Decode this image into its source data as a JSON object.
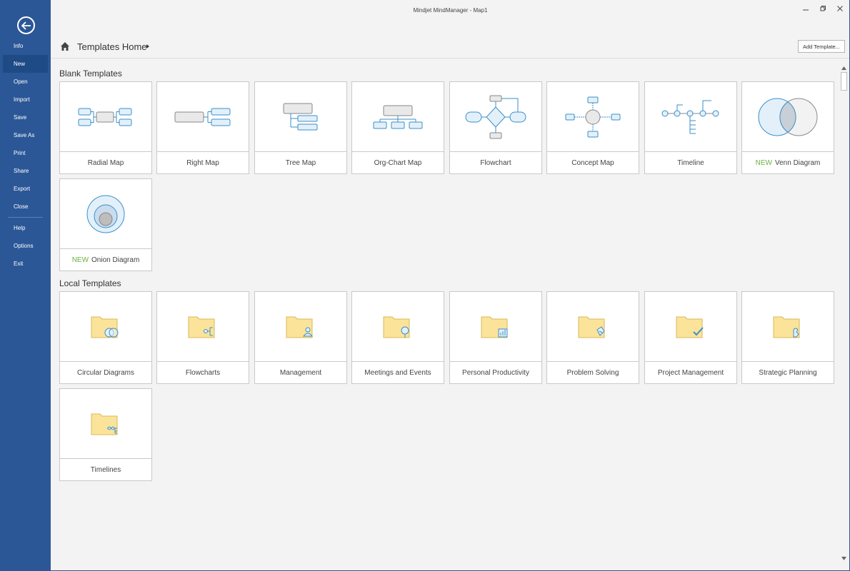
{
  "window": {
    "title": "Mindjet MindManager - Map1"
  },
  "sidebar": {
    "items": [
      {
        "label": "Info"
      },
      {
        "label": "New"
      },
      {
        "label": "Open"
      },
      {
        "label": "Import"
      },
      {
        "label": "Save"
      },
      {
        "label": "Save As"
      },
      {
        "label": "Print"
      },
      {
        "label": "Share"
      },
      {
        "label": "Export"
      },
      {
        "label": "Close"
      },
      {
        "label": "Help"
      },
      {
        "label": "Options"
      },
      {
        "label": "Exit"
      }
    ],
    "active": "New"
  },
  "header": {
    "title": "Templates Home",
    "add_button": "Add Template..."
  },
  "sections": [
    {
      "title": "Blank Templates",
      "cards": [
        {
          "label": "Radial Map",
          "badge": ""
        },
        {
          "label": "Right Map",
          "badge": ""
        },
        {
          "label": "Tree Map",
          "badge": ""
        },
        {
          "label": "Org-Chart Map",
          "badge": ""
        },
        {
          "label": "Flowchart",
          "badge": ""
        },
        {
          "label": "Concept Map",
          "badge": ""
        },
        {
          "label": "Timeline",
          "badge": ""
        },
        {
          "label": "Venn Diagram",
          "badge": "NEW"
        },
        {
          "label": "Onion Diagram",
          "badge": "NEW"
        }
      ]
    },
    {
      "title": "Local Templates",
      "cards": [
        {
          "label": "Circular Diagrams"
        },
        {
          "label": "Flowcharts"
        },
        {
          "label": "Management"
        },
        {
          "label": "Meetings and Events"
        },
        {
          "label": "Personal Productivity"
        },
        {
          "label": "Problem Solving"
        },
        {
          "label": "Project Management"
        },
        {
          "label": "Strategic Planning"
        },
        {
          "label": "Timelines"
        }
      ]
    }
  ],
  "colors": {
    "sidebar": "#2b5797",
    "accent_new": "#6cb33f",
    "diagram_stroke": "#3a8fc8",
    "folder": "#fbe39a"
  }
}
